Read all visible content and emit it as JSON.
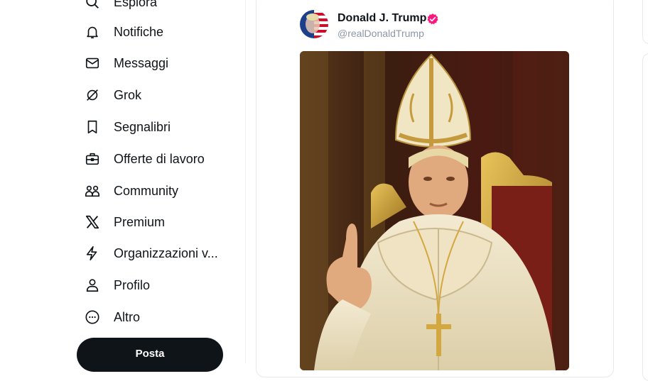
{
  "sidebar": {
    "items": [
      {
        "label": "Esplora",
        "icon": "search-icon"
      },
      {
        "label": "Notifiche",
        "icon": "bell-icon"
      },
      {
        "label": "Messaggi",
        "icon": "envelope-icon"
      },
      {
        "label": "Grok",
        "icon": "grok-icon"
      },
      {
        "label": "Segnalibri",
        "icon": "bookmark-icon"
      },
      {
        "label": "Offerte di lavoro",
        "icon": "briefcase-icon"
      },
      {
        "label": "Community",
        "icon": "people-icon"
      },
      {
        "label": "Premium",
        "icon": "x-logo-icon"
      },
      {
        "label": "Organizzazioni v...",
        "icon": "lightning-icon"
      },
      {
        "label": "Profilo",
        "icon": "person-icon"
      },
      {
        "label": "Altro",
        "icon": "more-circle-icon"
      }
    ],
    "post_button": "Posta"
  },
  "post": {
    "author_name": "Donald J. Trump",
    "handle": "@realDonaldTrump",
    "verified_color": "#f91880",
    "image_description": "Image of a man dressed in papal vestments and mitre seated on a gilded throne, raising his index finger"
  },
  "colors": {
    "text": "#0f1419",
    "secondary": "#8b98a5",
    "post_button_bg": "#0f1419",
    "border": "#e6e9eb"
  }
}
